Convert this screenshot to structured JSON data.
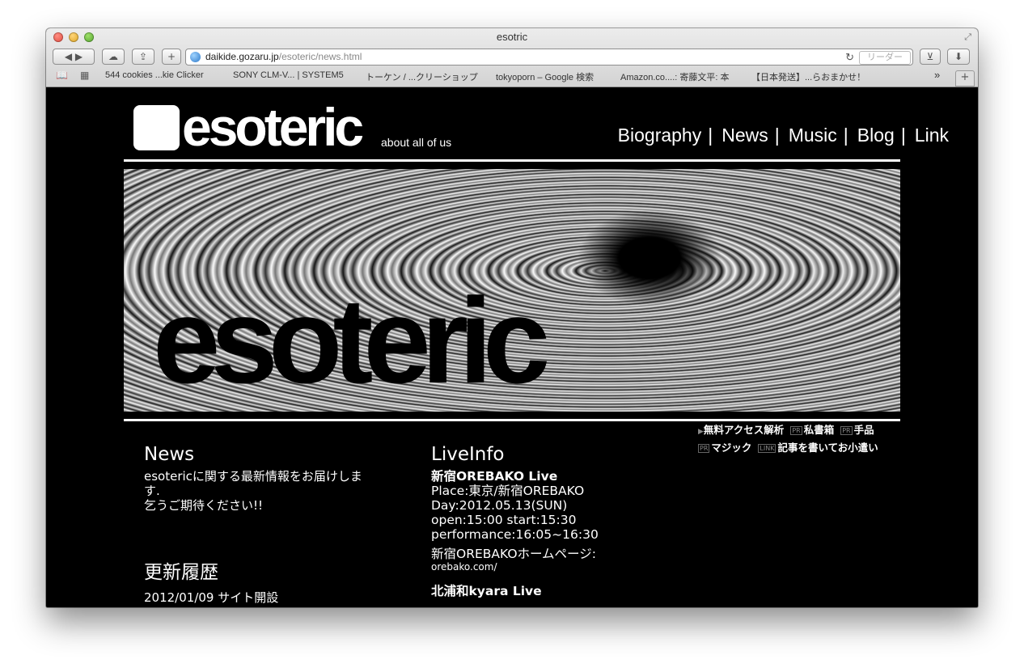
{
  "window": {
    "title": "esotric",
    "url_host": "daikide.gozaru.jp",
    "url_path": "/esoteric/news.html",
    "reader_label": "リーダー"
  },
  "bookmarks": [
    "544 cookies ...kie Clicker",
    "SONY CLM-V... | SYSTEM5",
    "トーケン / ...クリーショップ",
    "tokyoporn – Google 検索",
    "Amazon.co....: 寄藤文平: 本",
    "【日本発送】...らおまかせ！"
  ],
  "site": {
    "logo": "esoteric",
    "tagline": "about all of us",
    "nav": [
      "Biography",
      "News",
      "Music",
      "Blog",
      "Link"
    ],
    "hero_word": "esoteric"
  },
  "pr": {
    "line1": [
      "無料アクセス解析",
      "私書箱",
      "手品"
    ],
    "line2": [
      "マジック",
      "記事を書いてお小遣い"
    ],
    "tag_pr": "PR",
    "tag_link": "LINK"
  },
  "news": {
    "heading": "News",
    "text1": "esotericに関する最新情報をお届けしま",
    "text2": "す.",
    "text3": "乞うご期待ください!!"
  },
  "history": {
    "heading": "更新履歴",
    "item": "2012/01/09 サイト開設"
  },
  "live": {
    "heading": "LiveInfo",
    "event1_title": "新宿OREBAKO Live",
    "event1_place": "Place:東京/新宿OREBAKO",
    "event1_day": "Day:2012.05.13(SUN)",
    "event1_open": "open:15:00 start:15:30",
    "event1_perf": "performance:16:05~16:30",
    "hp_label": "新宿OREBAKOホームページ:",
    "hp_url": "orebako.com/",
    "event2_title": "北浦和kyara Live"
  }
}
